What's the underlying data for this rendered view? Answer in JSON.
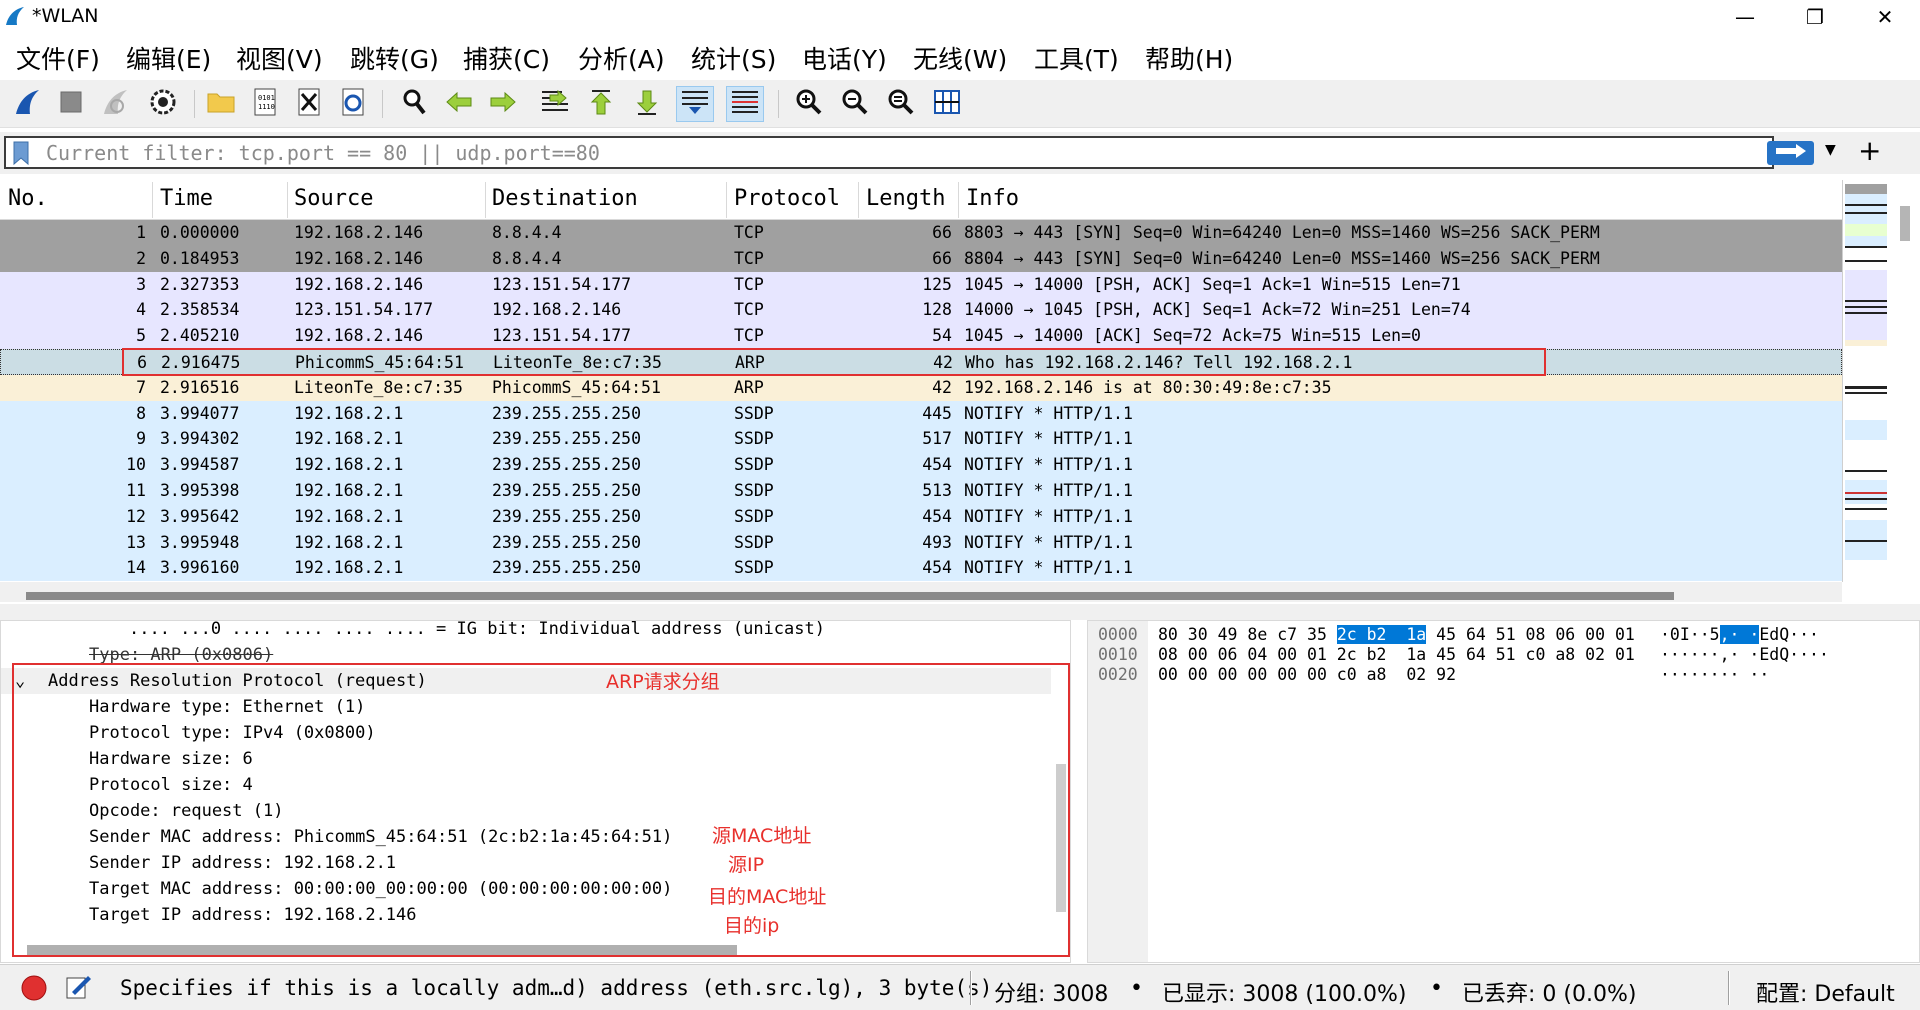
{
  "window": {
    "title": "*WLAN"
  },
  "menu": [
    "文件(F)",
    "编辑(E)",
    "视图(V)",
    "跳转(G)",
    "捕获(C)",
    "分析(A)",
    "统计(S)",
    "电话(Y)",
    "无线(W)",
    "工具(T)",
    "帮助(H)"
  ],
  "toolbar": {
    "icons": [
      "shark-fin-start-icon",
      "stop-capture-icon",
      "restart-capture-icon",
      "capture-options-icon",
      "open-file-icon",
      "file-binary-icon",
      "close-file-icon",
      "reload-file-icon",
      "find-packet-icon",
      "go-back-icon",
      "go-forward-icon",
      "go-to-packet-icon",
      "go-first-icon",
      "go-last-icon",
      "auto-scroll-icon",
      "colorize-icon",
      "zoom-in-icon",
      "zoom-out-icon",
      "zoom-normal-icon",
      "resize-columns-icon"
    ]
  },
  "filter": {
    "value": "",
    "placeholder": "Current filter: tcp.port == 80 || udp.port==80"
  },
  "packet_list": {
    "columns": [
      "No.",
      "Time",
      "Source",
      "Destination",
      "Protocol",
      "Length",
      "Info"
    ],
    "rows": [
      {
        "no": "1",
        "time": "0.000000",
        "src": "192.168.2.146",
        "dst": "8.8.4.4",
        "proto": "TCP",
        "len": "66",
        "info": "8803 → 443 [SYN] Seq=0 Win=64240 Len=0 MSS=1460 WS=256 SACK_PERM",
        "bg": "#a0a0a0",
        "fg": "#000000"
      },
      {
        "no": "2",
        "time": "0.184953",
        "src": "192.168.2.146",
        "dst": "8.8.4.4",
        "proto": "TCP",
        "len": "66",
        "info": "8804 → 443 [SYN] Seq=0 Win=64240 Len=0 MSS=1460 WS=256 SACK_PERM",
        "bg": "#a0a0a0",
        "fg": "#000000"
      },
      {
        "no": "3",
        "time": "2.327353",
        "src": "192.168.2.146",
        "dst": "123.151.54.177",
        "proto": "TCP",
        "len": "125",
        "info": "1045 → 14000 [PSH, ACK] Seq=1 Ack=1 Win=515 Len=71",
        "bg": "#e7e6ff",
        "fg": "#000000"
      },
      {
        "no": "4",
        "time": "2.358534",
        "src": "123.151.54.177",
        "dst": "192.168.2.146",
        "proto": "TCP",
        "len": "128",
        "info": "14000 → 1045 [PSH, ACK] Seq=1 Ack=72 Win=251 Len=74",
        "bg": "#e7e6ff",
        "fg": "#000000"
      },
      {
        "no": "5",
        "time": "2.405210",
        "src": "192.168.2.146",
        "dst": "123.151.54.177",
        "proto": "TCP",
        "len": "54",
        "info": "1045 → 14000 [ACK] Seq=72 Ack=75 Win=515 Len=0",
        "bg": "#e7e6ff",
        "fg": "#000000"
      },
      {
        "no": "6",
        "time": "2.916475",
        "src": "PhicommS_45:64:51",
        "dst": "LiteonTe_8e:c7:35",
        "proto": "ARP",
        "len": "42",
        "info": "Who has 192.168.2.146? Tell 192.168.2.1",
        "bg": "#cbdde4",
        "fg": "#000000"
      },
      {
        "no": "7",
        "time": "2.916516",
        "src": "LiteonTe_8e:c7:35",
        "dst": "PhicommS_45:64:51",
        "proto": "ARP",
        "len": "42",
        "info": "192.168.2.146 is at 80:30:49:8e:c7:35",
        "bg": "#faf0d7",
        "fg": "#000000"
      },
      {
        "no": "8",
        "time": "3.994077",
        "src": "192.168.2.1",
        "dst": "239.255.255.250",
        "proto": "SSDP",
        "len": "445",
        "info": "NOTIFY * HTTP/1.1",
        "bg": "#daeeff",
        "fg": "#000000"
      },
      {
        "no": "9",
        "time": "3.994302",
        "src": "192.168.2.1",
        "dst": "239.255.255.250",
        "proto": "SSDP",
        "len": "517",
        "info": "NOTIFY * HTTP/1.1",
        "bg": "#daeeff",
        "fg": "#000000"
      },
      {
        "no": "10",
        "time": "3.994587",
        "src": "192.168.2.1",
        "dst": "239.255.255.250",
        "proto": "SSDP",
        "len": "454",
        "info": "NOTIFY * HTTP/1.1",
        "bg": "#daeeff",
        "fg": "#000000"
      },
      {
        "no": "11",
        "time": "3.995398",
        "src": "192.168.2.1",
        "dst": "239.255.255.250",
        "proto": "SSDP",
        "len": "513",
        "info": "NOTIFY * HTTP/1.1",
        "bg": "#daeeff",
        "fg": "#000000"
      },
      {
        "no": "12",
        "time": "3.995642",
        "src": "192.168.2.1",
        "dst": "239.255.255.250",
        "proto": "SSDP",
        "len": "454",
        "info": "NOTIFY * HTTP/1.1",
        "bg": "#daeeff",
        "fg": "#000000"
      },
      {
        "no": "13",
        "time": "3.995948",
        "src": "192.168.2.1",
        "dst": "239.255.255.250",
        "proto": "SSDP",
        "len": "493",
        "info": "NOTIFY * HTTP/1.1",
        "bg": "#daeeff",
        "fg": "#000000"
      },
      {
        "no": "14",
        "time": "3.996160",
        "src": "192.168.2.1",
        "dst": "239.255.255.250",
        "proto": "SSDP",
        "len": "454",
        "info": "NOTIFY * HTTP/1.1",
        "bg": "#daeeff",
        "fg": "#000000"
      }
    ]
  },
  "details": {
    "lines": [
      {
        "text": ".... ...0 .... .... .... .... = IG bit: Individual address (unicast)",
        "indent": 1,
        "toggle": "",
        "strike": false
      },
      {
        "text": "Type: ARP (0x0806)",
        "indent": 0,
        "toggle": "",
        "strike": true
      },
      {
        "text": "Address Resolution Protocol (request)",
        "indent": 0,
        "toggle": "⌄",
        "strike": false
      },
      {
        "text": "Hardware type: Ethernet (1)",
        "indent": 1,
        "toggle": "",
        "strike": false
      },
      {
        "text": "Protocol type: IPv4 (0x0800)",
        "indent": 1,
        "toggle": "",
        "strike": false
      },
      {
        "text": "Hardware size: 6",
        "indent": 1,
        "toggle": "",
        "strike": false
      },
      {
        "text": "Protocol size: 4",
        "indent": 1,
        "toggle": "",
        "strike": false
      },
      {
        "text": "Opcode: request (1)",
        "indent": 1,
        "toggle": "",
        "strike": false
      },
      {
        "text": "Sender MAC address: PhicommS_45:64:51 (2c:b2:1a:45:64:51)",
        "indent": 1,
        "toggle": "",
        "strike": false
      },
      {
        "text": "Sender IP address: 192.168.2.1",
        "indent": 1,
        "toggle": "",
        "strike": false
      },
      {
        "text": "Target MAC address: 00:00:00_00:00:00 (00:00:00:00:00:00)",
        "indent": 1,
        "toggle": "",
        "strike": false
      },
      {
        "text": "Target IP address: 192.168.2.146",
        "indent": 1,
        "toggle": "",
        "strike": false
      }
    ]
  },
  "hex": {
    "offsets": [
      "0000",
      "0010",
      "0020"
    ],
    "rows": [
      {
        "pre": "80 30 49 8e c7 35 ",
        "hl": "2c b2  1a",
        "post": " 45 64 51 08 06 00 01",
        "ascii_pre": "·0I··5",
        "ascii_hl": ",· ·",
        "ascii_post": "EdQ···"
      },
      {
        "pre": "08 00 06 04 00 01 2c b2  1a 45 64 51 c0 a8 02 01",
        "hl": "",
        "post": "",
        "ascii_pre": "······,· ·EdQ····",
        "ascii_hl": "",
        "ascii_post": ""
      },
      {
        "pre": "00 00 00 00 00 00 c0 a8  02 92",
        "hl": "",
        "post": "",
        "ascii_pre": "········ ··",
        "ascii_hl": "",
        "ascii_post": ""
      }
    ]
  },
  "annotations": {
    "arp_group": "ARP请求分组",
    "src_mac": "源MAC地址",
    "src_ip": "源IP",
    "dst_mac": "目的MAC地址",
    "dst_ip": "目的ip"
  },
  "status": {
    "message": "Specifies if this is a locally adm…d) address (eth.src.lg), 3 byte(s)",
    "packets": "分组: 3008",
    "displayed": "已显示: 3008 (100.0%)",
    "dropped": "已丢弃: 0 (0.0%)",
    "profile": "配置: Default"
  },
  "colors": {
    "accent": "#0078d7",
    "annotation": "#e03030",
    "filter_apply": "#2673c6"
  }
}
